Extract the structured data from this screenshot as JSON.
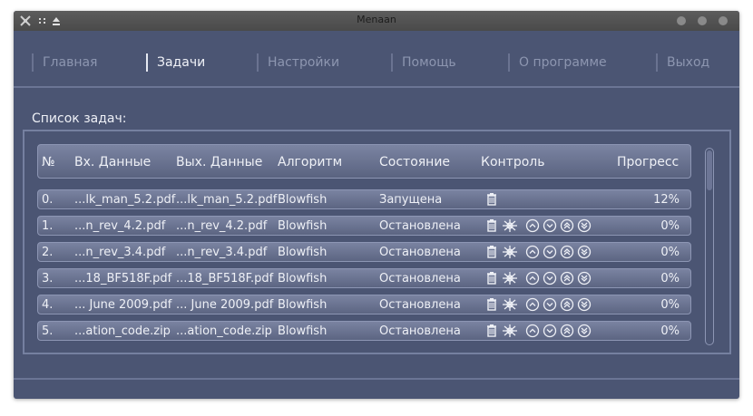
{
  "window": {
    "title": "Menaan"
  },
  "menu": {
    "items": [
      {
        "label": "Главная",
        "active": false
      },
      {
        "label": "Задачи",
        "active": true
      },
      {
        "label": "Настройки",
        "active": false
      },
      {
        "label": "Помощь",
        "active": false
      },
      {
        "label": "О программе",
        "active": false
      },
      {
        "label": "Выход",
        "active": false
      }
    ]
  },
  "tasks": {
    "title": "Список задач:",
    "columns": {
      "num": "№",
      "input": "Вх. Данные",
      "output": "Вых. Данные",
      "algorithm": "Алгоритм",
      "state": "Состояние",
      "control": "Контроль",
      "progress": "Прогресс"
    },
    "rows": [
      {
        "num": "0.",
        "input": "...lk_man_5.2.pdf",
        "output": "...lk_man_5.2.pdf",
        "algorithm": "Blowfish",
        "state": "Запущена",
        "progress": "12%",
        "running": true
      },
      {
        "num": "1.",
        "input": "...n_rev_4.2.pdf",
        "output": "...n_rev_4.2.pdf",
        "algorithm": "Blowfish",
        "state": "Остановлена",
        "progress": "0%",
        "running": false
      },
      {
        "num": "2.",
        "input": "...n_rev_3.4.pdf",
        "output": "...n_rev_3.4.pdf",
        "algorithm": "Blowfish",
        "state": "Остановлена",
        "progress": "0%",
        "running": false
      },
      {
        "num": "3.",
        "input": "...18_BF518F.pdf",
        "output": "...18_BF518F.pdf",
        "algorithm": "Blowfish",
        "state": "Остановлена",
        "progress": "0%",
        "running": false
      },
      {
        "num": "4.",
        "input": "... June 2009.pdf",
        "output": "... June 2009.pdf",
        "algorithm": "Blowfish",
        "state": "Остановлена",
        "progress": "0%",
        "running": false
      },
      {
        "num": "5.",
        "input": "...ation_code.zip",
        "output": "...ation_code.zip",
        "algorithm": "Blowfish",
        "state": "Остановлена",
        "progress": "0%",
        "running": false
      }
    ]
  },
  "colors": {
    "window_bg": "#4b5573",
    "text": "#eef0f6",
    "inactive_menu": "#8d96b0"
  },
  "icons": [
    "app-icon",
    "grip-icon",
    "eject-icon",
    "trash-icon",
    "gear-icon",
    "arrow-up-icon",
    "arrow-down-icon",
    "arrow-top-icon",
    "arrow-bottom-icon"
  ]
}
